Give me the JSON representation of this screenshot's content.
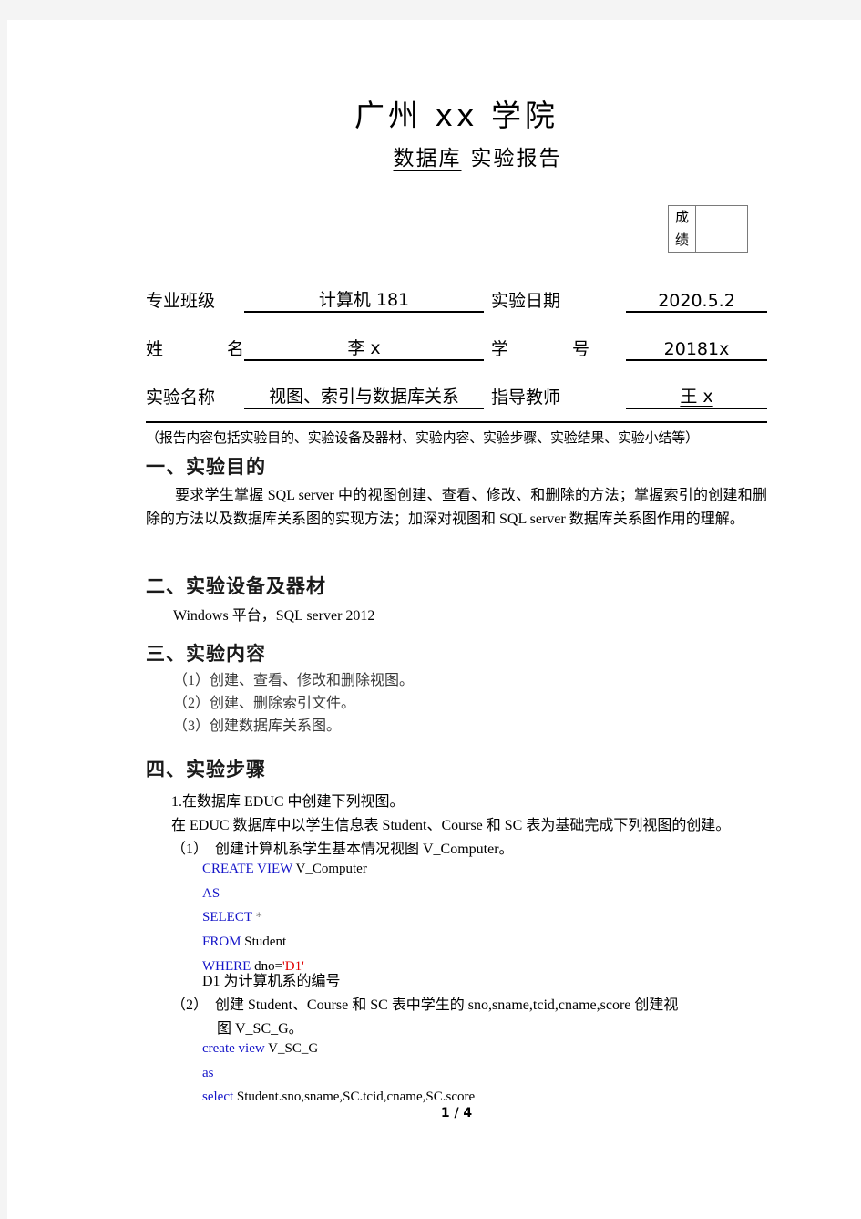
{
  "header": {
    "institution": "广州 xx 学院",
    "report_prefix": "数据库",
    "report_suffix": "实验报告"
  },
  "grade_box": {
    "label_line1": "成",
    "label_line2": "绩",
    "value": ""
  },
  "info": {
    "rows": [
      {
        "left_label": "专业班级",
        "left_value": "计算机 181",
        "right_label": "实验日期",
        "right_value": "2020.5.2"
      },
      {
        "left_label": "姓　　名",
        "left_value": "李 x",
        "right_label": "学　　号",
        "right_value": "20181x"
      },
      {
        "left_label": "实验名称",
        "left_value": "视图、索引与数据库关系",
        "right_label": "指导教师",
        "right_value": "王 x"
      }
    ]
  },
  "note": "（报告内容包括实验目的、实验设备及器材、实验内容、实验步骤、实验结果、实验小结等）",
  "sections": {
    "s1_heading": "一、实验目的",
    "s1_body": "要求学生掌握 SQL server 中的视图创建、查看、修改、和删除的方法；掌握索引的创建和删除的方法以及数据库关系图的实现方法；加深对视图和 SQL server 数据库关系图作用的理解。",
    "s2_heading": "二、实验设备及器材",
    "s2_body": "Windows 平台，SQL server 2012",
    "s3_heading": "三、实验内容",
    "s3_items": [
      "（1）创建、查看、修改和删除视图。",
      "（2）创建、删除索引文件。",
      "（3）创建数据库关系图。"
    ],
    "s4_heading": "四、实验步骤",
    "s4_step1": "1.在数据库 EDUC 中创建下列视图。",
    "s4_step1_note": "在 EDUC 数据库中以学生信息表 Student、Course 和 SC 表为基础完成下列视图的创建。",
    "s4_item1": "（1）　创建计算机系学生基本情况视图 V_Computer。",
    "s4_item2_line1": "（2）　创建 Student、Course 和 SC 表中学生的 sno,sname,tcid,cname,score 创建视",
    "s4_item2_line2": "图 V_SC_G。",
    "d1_note": "D1 为计算机系的编号"
  },
  "code1": {
    "lines": [
      {
        "kw": "CREATE VIEW",
        "rest": " V_Computer"
      },
      {
        "kw": "AS",
        "rest": ""
      },
      {
        "kw": "SELECT",
        "op": " *",
        "rest": ""
      },
      {
        "kw": "FROM",
        "rest": " Student"
      },
      {
        "kw": "WHERE",
        "rest": " dno=",
        "str": "'D1'"
      }
    ]
  },
  "code2": {
    "lines": [
      {
        "kw": "create view",
        "rest": " V_SC_G"
      },
      {
        "kw": "as",
        "rest": ""
      },
      {
        "kw": "select",
        "rest": " Student.sno,sname,SC.tcid,cname,SC.score"
      }
    ]
  },
  "footer": {
    "page": "1 / 4"
  },
  "colors": {
    "keyword": "#1414c8",
    "string": "#e00000",
    "operator": "#808080",
    "page_bg": "#ffffff",
    "canvas_bg": "#f4f4f4",
    "grade_border": "#7a7a7a"
  }
}
